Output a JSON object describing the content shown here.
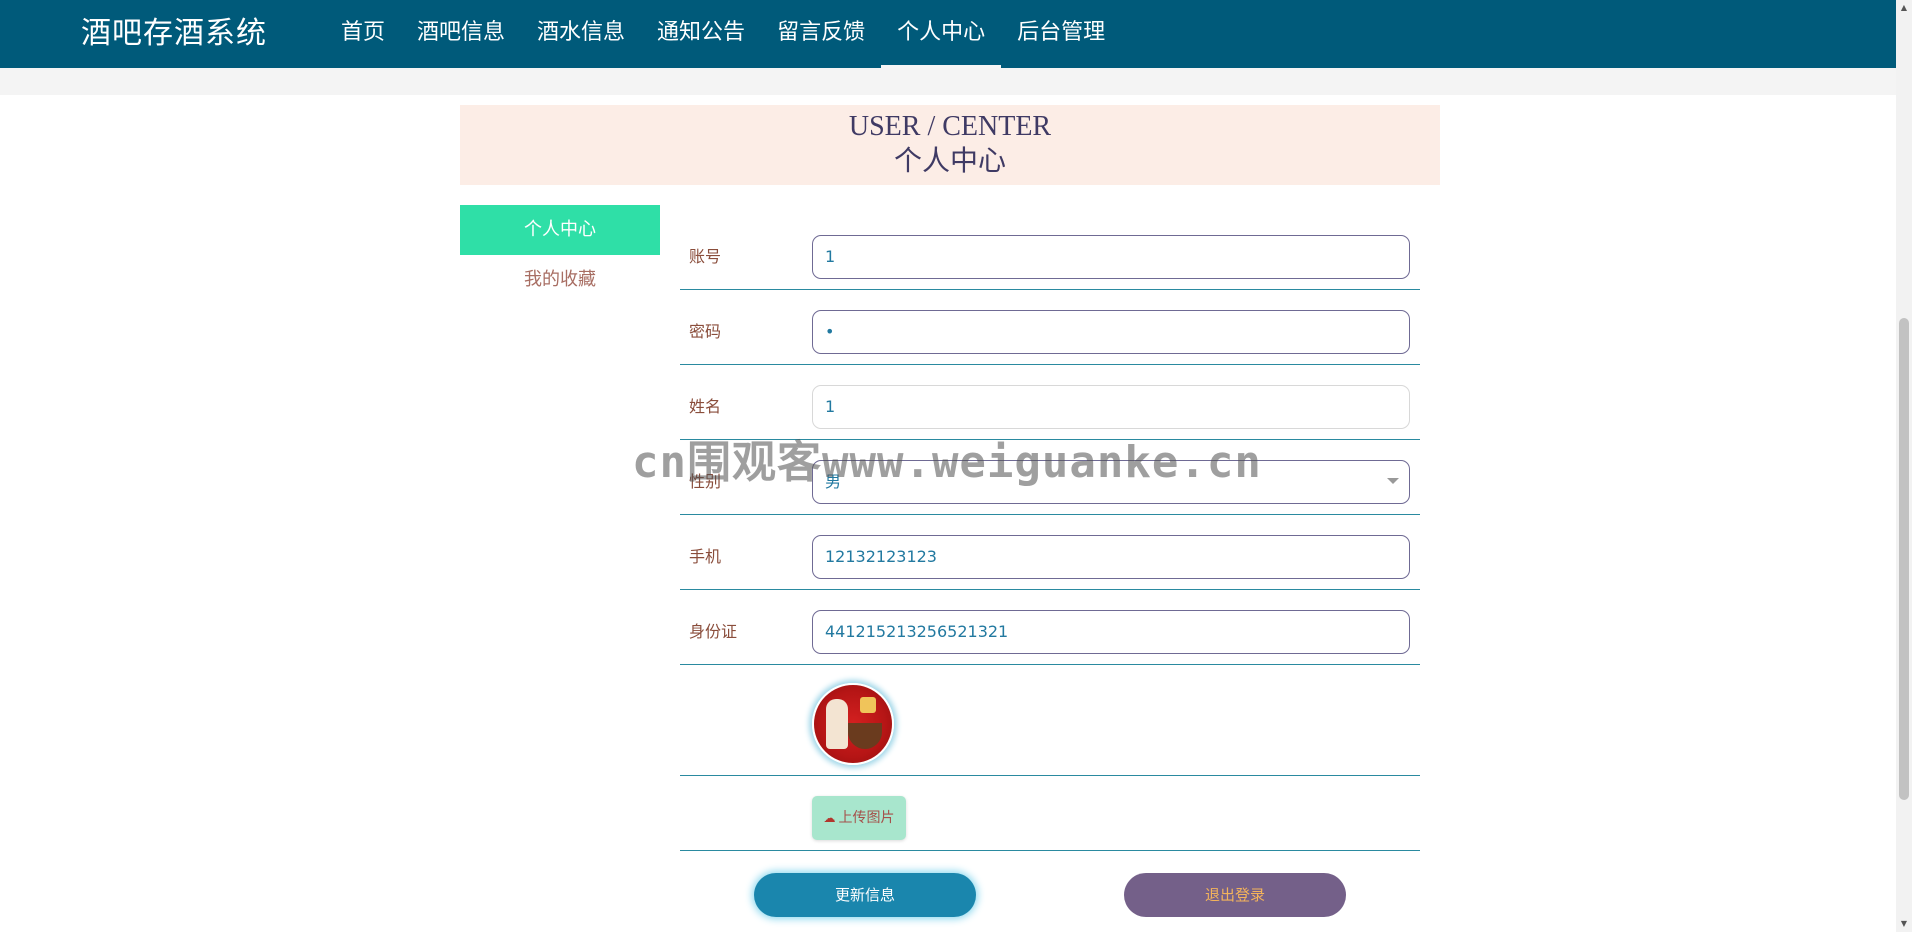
{
  "header": {
    "brand": "酒吧存酒系统",
    "nav": [
      {
        "label": "首页",
        "active": false
      },
      {
        "label": "酒吧信息",
        "active": false
      },
      {
        "label": "酒水信息",
        "active": false
      },
      {
        "label": "通知公告",
        "active": false
      },
      {
        "label": "留言反馈",
        "active": false
      },
      {
        "label": "个人中心",
        "active": true
      },
      {
        "label": "后台管理",
        "active": false
      }
    ]
  },
  "banner": {
    "en": "USER / CENTER",
    "cn": "个人中心"
  },
  "sidebar": {
    "items": [
      {
        "label": "个人中心",
        "active": true
      },
      {
        "label": "我的收藏",
        "active": false
      }
    ]
  },
  "form": {
    "account": {
      "label": "账号",
      "value": "1"
    },
    "password": {
      "label": "密码",
      "value": "•"
    },
    "name": {
      "label": "姓名",
      "value": "1"
    },
    "gender": {
      "label": "性别",
      "value": "男"
    },
    "phone": {
      "label": "手机",
      "value": "12132123123"
    },
    "id_card": {
      "label": "身份证",
      "value": "441215213256521321"
    },
    "upload_label": "上传图片"
  },
  "buttons": {
    "update": "更新信息",
    "logout": "退出登录"
  },
  "watermark": "cn围观客www.weiguanke.cn",
  "colors": {
    "header_bg": "#005a7a",
    "accent_green": "#2fdfa7",
    "update_btn": "#1a86ad",
    "logout_btn": "#746089",
    "banner_bg": "#fcede6"
  },
  "icons": {
    "upload": "cloud-upload-icon",
    "select": "chevron-down-icon"
  }
}
